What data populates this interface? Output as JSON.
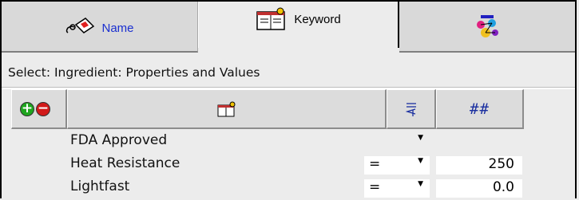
{
  "tabs": [
    {
      "label": "Name",
      "icon": "name-tag-icon",
      "active": false
    },
    {
      "label": "Keyword",
      "icon": "keyword-book-icon",
      "active": true
    },
    {
      "label": "",
      "icon": "molecule-icon",
      "active": false
    }
  ],
  "select_label": "Select: Ingredient: Properties and Values",
  "grid": {
    "headers": {
      "add_remove": "add-remove-icons",
      "property": "keyword-book-icon",
      "operator": "sort-icon",
      "value": "##"
    },
    "rows": [
      {
        "name": "FDA Approved",
        "operator": "",
        "value": ""
      },
      {
        "name": "Heat Resistance",
        "operator": "=",
        "value": "250"
      },
      {
        "name": "Lightfast",
        "operator": "=",
        "value": "0.0"
      }
    ]
  },
  "colors": {
    "link_blue": "#1a2fd0",
    "add_green": "#1fa51f",
    "remove_red": "#d21a1a"
  }
}
